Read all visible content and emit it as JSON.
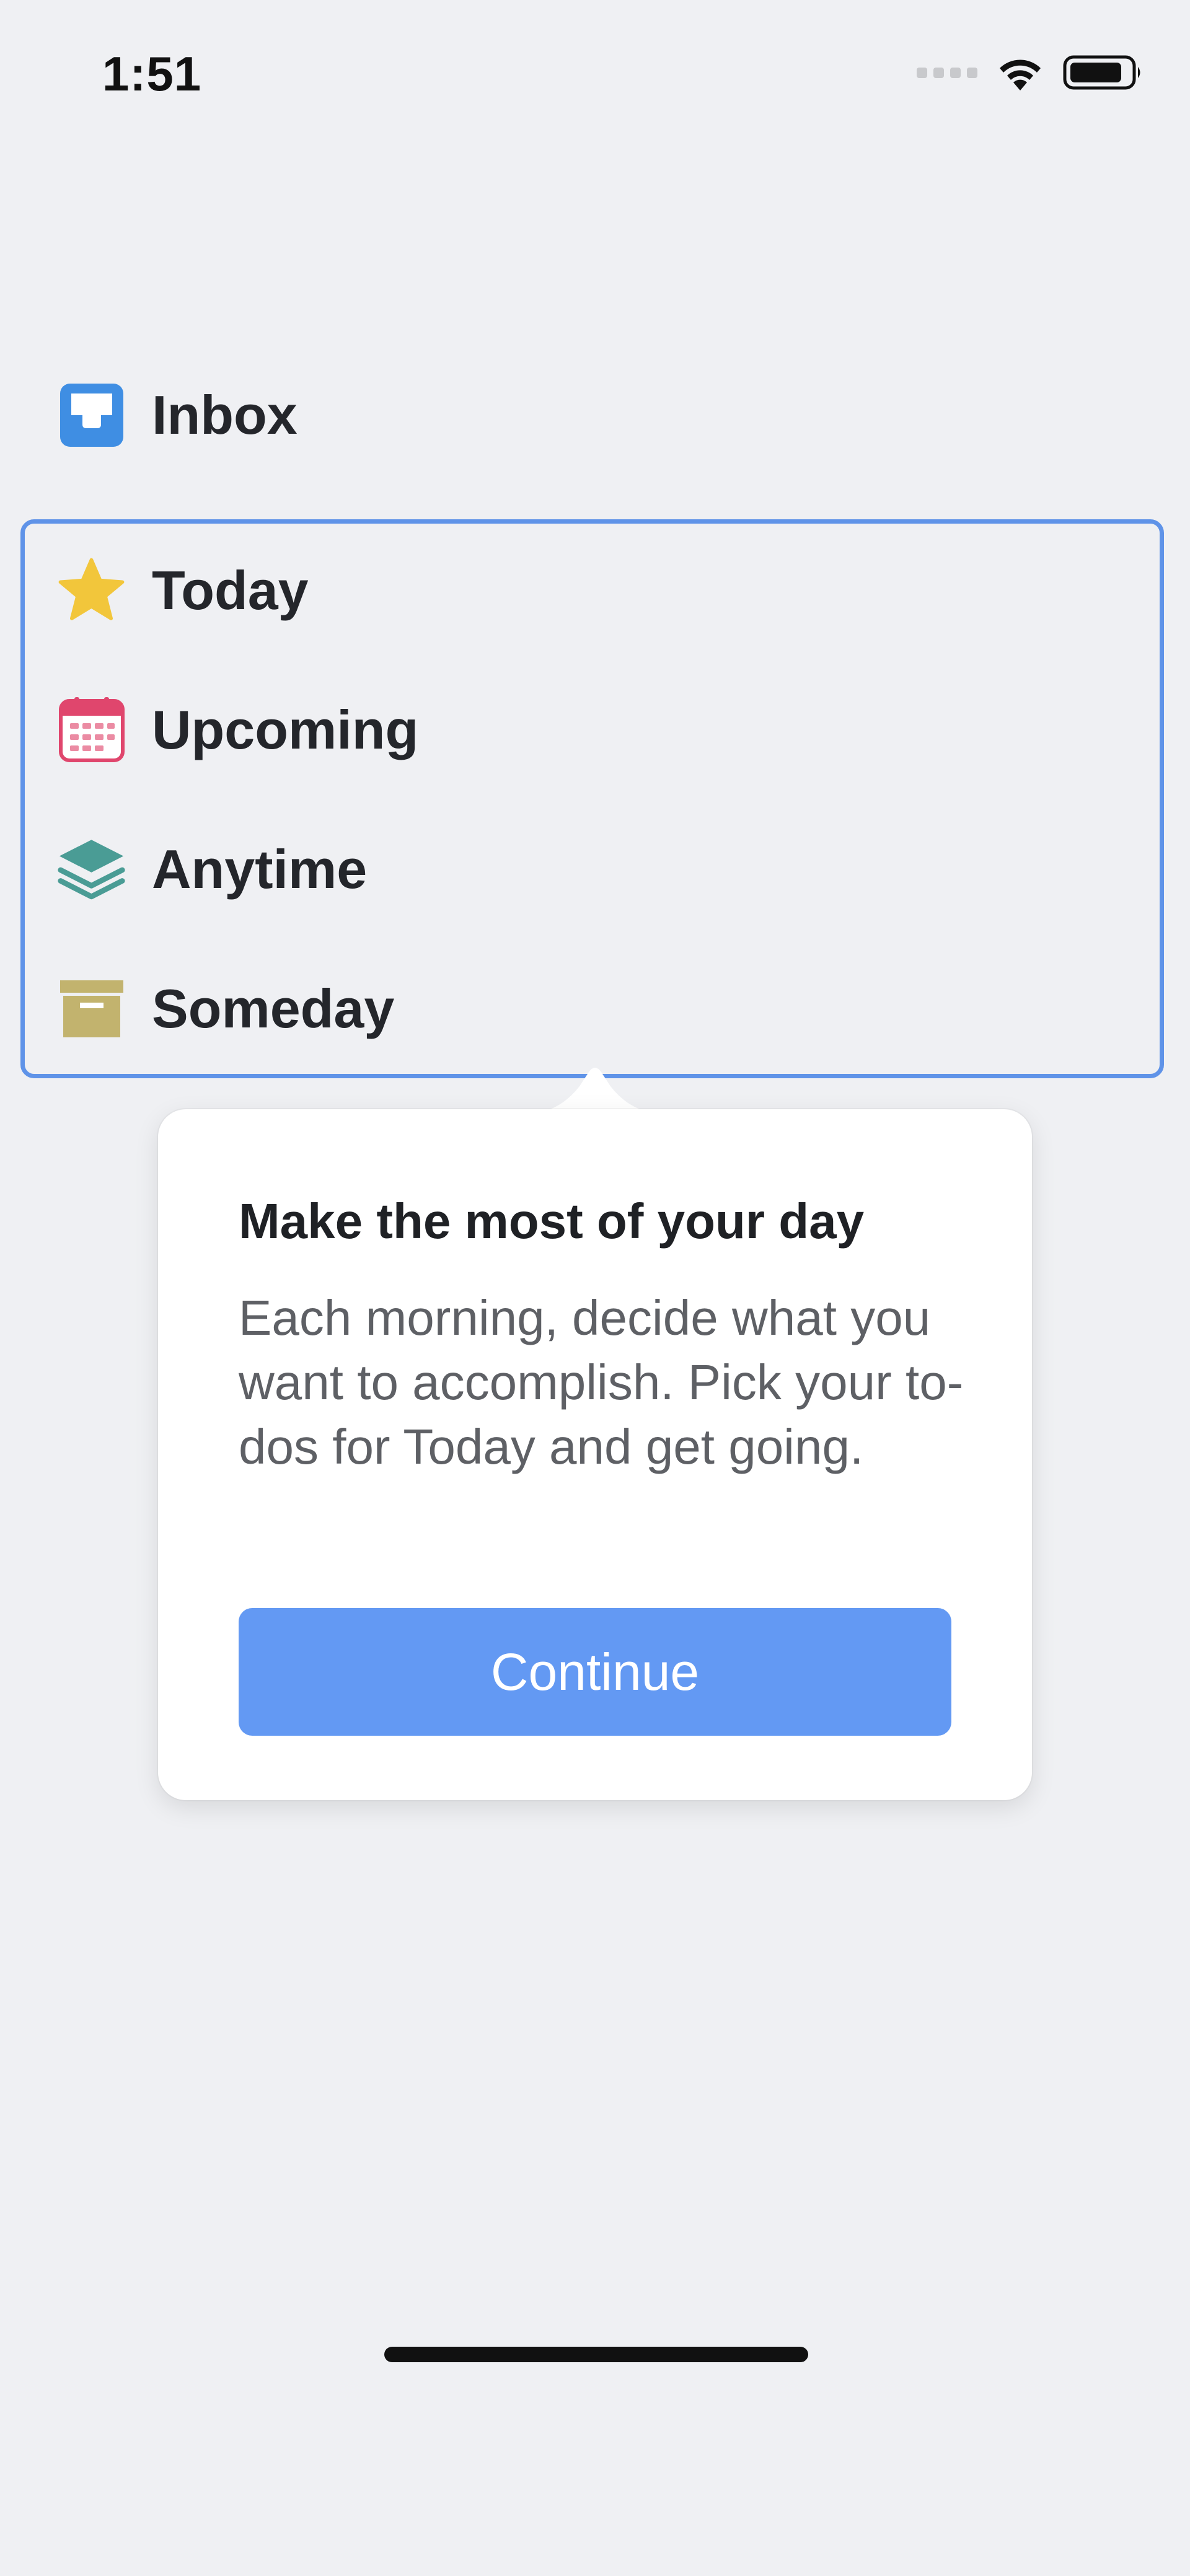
{
  "status_bar": {
    "time": "1:51"
  },
  "sidebar": {
    "items": [
      {
        "label": "Inbox",
        "icon": "inbox-icon",
        "color": "#3f8ee3"
      },
      {
        "label": "Today",
        "icon": "star-icon",
        "color": "#f2c63b"
      },
      {
        "label": "Upcoming",
        "icon": "calendar-icon",
        "color": "#e0466d"
      },
      {
        "label": "Anytime",
        "icon": "layers-icon",
        "color": "#4a9c95"
      },
      {
        "label": "Someday",
        "icon": "archive-box-icon",
        "color": "#c2b36e"
      }
    ]
  },
  "tooltip": {
    "title": "Make the most of your day",
    "body": "Each morning, decide what you want to accomplish. Pick your to-dos for Today and get going.",
    "button_label": "Continue"
  },
  "colors": {
    "accent": "#6399f3",
    "highlight_border": "#5f93e8",
    "background": "#eff0f3"
  }
}
